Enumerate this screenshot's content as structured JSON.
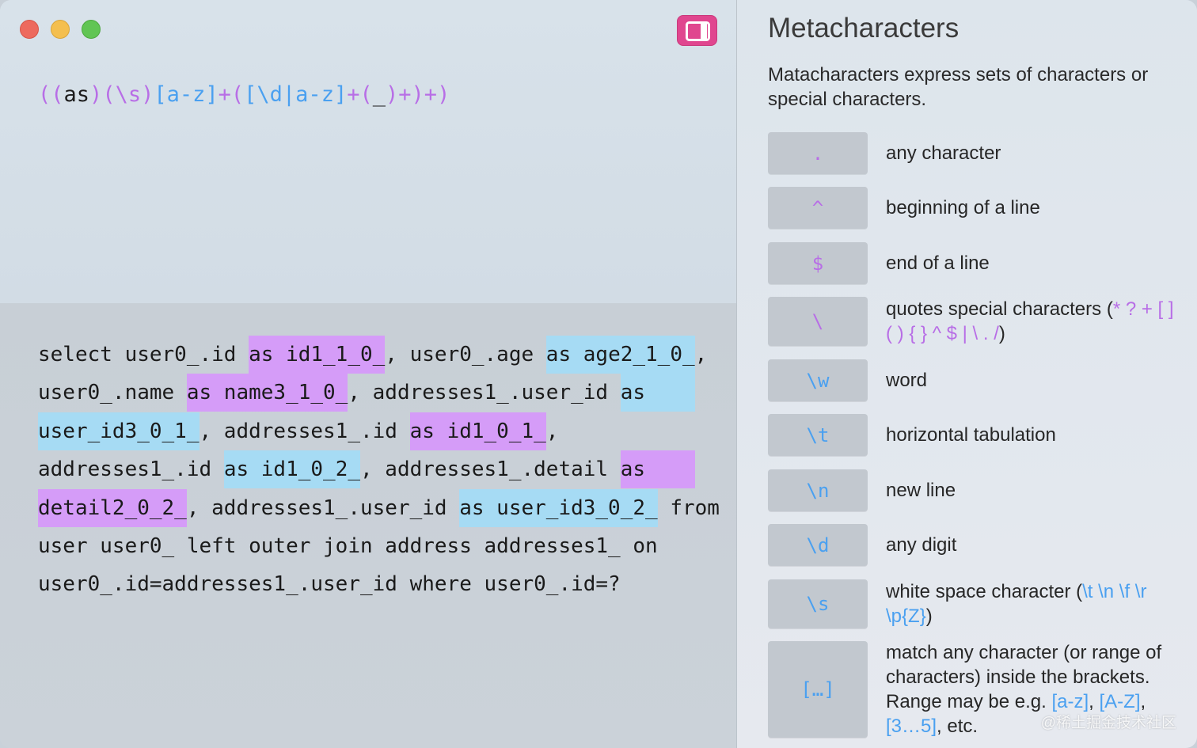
{
  "colors": {
    "accent_pink": "#e0468f",
    "regex_purple": "#b86ee6",
    "regex_blue": "#4aa0f0",
    "highlight_purple": "#d59cf8",
    "highlight_blue": "#a6dbf4"
  },
  "toolbar": {
    "sidebar_toggle_icon": "sidebar-right-icon"
  },
  "regex": {
    "tokens": [
      {
        "t": "(",
        "c": "purple"
      },
      {
        "t": "(",
        "c": "purple"
      },
      {
        "t": "as",
        "c": "dark"
      },
      {
        "t": ")",
        "c": "purple"
      },
      {
        "t": "(\\s)",
        "c": "purple"
      },
      {
        "t": "[a-z]",
        "c": "blue"
      },
      {
        "t": "+",
        "c": "purple"
      },
      {
        "t": "(",
        "c": "purple"
      },
      {
        "t": "[\\d|a-z]",
        "c": "blue"
      },
      {
        "t": "+",
        "c": "purple"
      },
      {
        "t": "(",
        "c": "purple"
      },
      {
        "t": "_",
        "c": "dark"
      },
      {
        "t": ")",
        "c": "purple"
      },
      {
        "t": "+",
        "c": "purple"
      },
      {
        "t": ")",
        "c": "purple"
      },
      {
        "t": "+",
        "c": "purple"
      },
      {
        "t": ")",
        "c": "purple"
      }
    ]
  },
  "test_text": {
    "lines": [
      [
        {
          "t": "select user0_.id "
        },
        {
          "t": "as id1_1_0_",
          "h": "p"
        },
        {
          "t": ", user0_.age "
        },
        {
          "t": "as age2_1_0_",
          "h": "b"
        },
        {
          "t": ","
        }
      ],
      [
        {
          "t": "user0_.name "
        },
        {
          "t": "as name3_1_0_",
          "h": "p"
        },
        {
          "t": ", addresses1_.user_id "
        },
        {
          "t": "as    ",
          "h": "b"
        }
      ],
      [
        {
          "t": "user_id3_0_1_",
          "h": "b"
        },
        {
          "t": ", addresses1_.id "
        },
        {
          "t": "as id1_0_1_",
          "h": "p"
        },
        {
          "t": ","
        }
      ],
      [
        {
          "t": "addresses1_.id "
        },
        {
          "t": "as id1_0_2_",
          "h": "b"
        },
        {
          "t": ", addresses1_.detail "
        },
        {
          "t": "as    ",
          "h": "p"
        }
      ],
      [
        {
          "t": "detail2_0_2_",
          "h": "p"
        },
        {
          "t": ", addresses1_.user_id "
        },
        {
          "t": "as user_id3_0_2_",
          "h": "b"
        },
        {
          "t": " from"
        }
      ],
      [
        {
          "t": "user user0_ left outer join address addresses1_ on"
        }
      ],
      [
        {
          "t": "user0_.id=addresses1_.user_id where user0_.id=?"
        }
      ]
    ]
  },
  "reference": {
    "title": "Metacharacters",
    "description": "Matacharacters express sets of characters or special characters.",
    "items": [
      {
        "key": ".",
        "key_color": "purple",
        "desc": [
          {
            "t": "any character"
          }
        ]
      },
      {
        "key": "^",
        "key_color": "purple",
        "desc": [
          {
            "t": "beginning of a line"
          }
        ]
      },
      {
        "key": "$",
        "key_color": "purple",
        "desc": [
          {
            "t": "end of a line"
          }
        ]
      },
      {
        "key": "\\",
        "key_color": "purple",
        "desc": [
          {
            "t": "quotes special characters ("
          },
          {
            "t": "* ? + [ ] ( ) { } ^ $ | \\ . /",
            "c": "purple"
          },
          {
            "t": ")"
          }
        ]
      },
      {
        "key": "\\w",
        "key_color": "blue",
        "desc": [
          {
            "t": "word"
          }
        ]
      },
      {
        "key": "\\t",
        "key_color": "blue",
        "desc": [
          {
            "t": "horizontal tabulation"
          }
        ]
      },
      {
        "key": "\\n",
        "key_color": "blue",
        "desc": [
          {
            "t": "new line"
          }
        ]
      },
      {
        "key": "\\d",
        "key_color": "blue",
        "desc": [
          {
            "t": "any digit"
          }
        ]
      },
      {
        "key": "\\s",
        "key_color": "blue",
        "desc": [
          {
            "t": "white space character ("
          },
          {
            "t": "\\t \\n \\f \\r \\p{Z}",
            "c": "blue"
          },
          {
            "t": ")"
          }
        ]
      },
      {
        "key": "[…]",
        "key_color": "blue",
        "desc": [
          {
            "t": "match any character (or range of characters) inside the brackets. Range may be e.g. "
          },
          {
            "t": "[a-z]",
            "c": "blue"
          },
          {
            "t": ", "
          },
          {
            "t": "[A-Z]",
            "c": "blue"
          },
          {
            "t": ", "
          },
          {
            "t": "[3…5]",
            "c": "blue"
          },
          {
            "t": ", etc."
          }
        ]
      }
    ]
  },
  "watermark": "@稀土掘金技术社区"
}
